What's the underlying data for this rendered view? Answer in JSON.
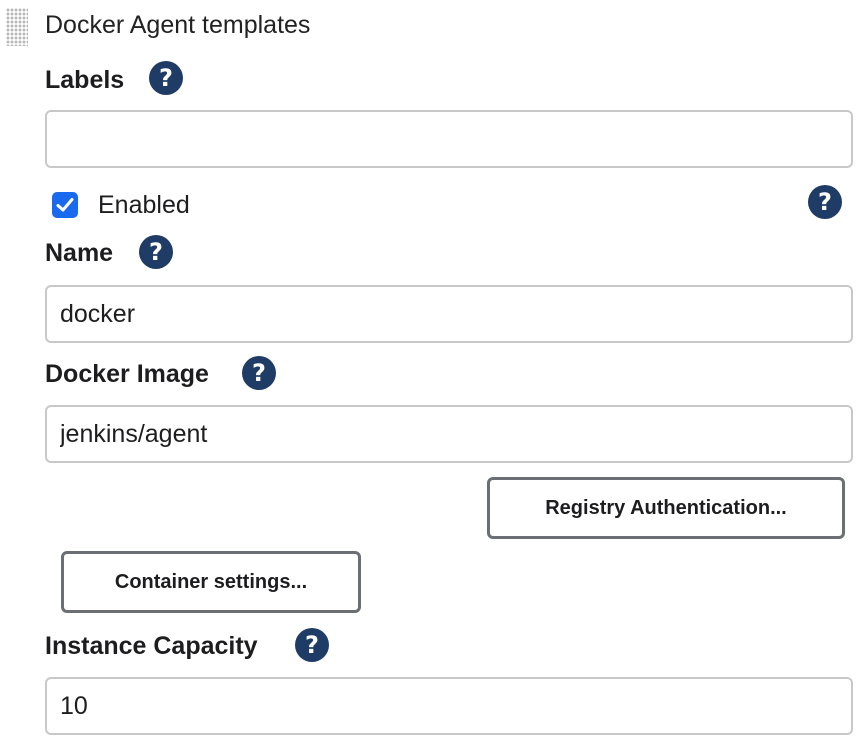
{
  "section": {
    "title": "Docker Agent templates"
  },
  "labels_field": {
    "label": "Labels",
    "value": "",
    "help": "?"
  },
  "enabled": {
    "label": "Enabled",
    "checked": true,
    "help": "?"
  },
  "name_field": {
    "label": "Name",
    "value": "docker",
    "help": "?"
  },
  "image_field": {
    "label": "Docker Image",
    "value": "jenkins/agent",
    "help": "?"
  },
  "buttons": {
    "registry_auth": "Registry Authentication...",
    "container_settings": "Container settings..."
  },
  "capacity_field": {
    "label": "Instance Capacity",
    "value": "10",
    "help": "?"
  },
  "colors": {
    "help_icon": "#1f3c66",
    "checkbox": "#1a6af0",
    "input_border": "#c8c8c8",
    "button_border": "#6b6f73"
  },
  "icons": {
    "drag": "drag-handle-icon",
    "help": "question-circle-icon",
    "check": "checkmark-icon"
  }
}
